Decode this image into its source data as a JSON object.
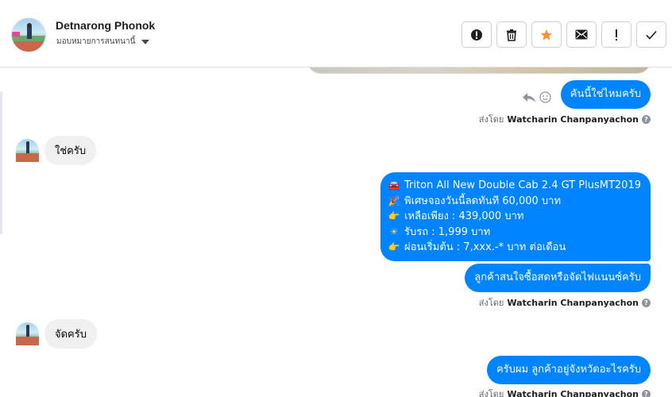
{
  "header": {
    "contact_name": "Detnarong Phonok",
    "assign_label": "มอบหมายการสนทนานี้"
  },
  "actions": [
    {
      "name": "spam-icon",
      "glyph": "!"
    },
    {
      "name": "trash-icon",
      "glyph": ""
    },
    {
      "name": "star-icon",
      "glyph": "★",
      "color": "#f7923b"
    },
    {
      "name": "mail-icon",
      "glyph": ""
    },
    {
      "name": "follow-up-icon",
      "glyph": "!"
    },
    {
      "name": "done-icon",
      "glyph": "✓"
    }
  ],
  "thread": {
    "msg1": "คันนี้ใช่ไหมครับ",
    "sent_by_prefix": "ส่งโดย",
    "sender": "Watcharin Chanpanyachon",
    "reply1": "ใช่ครับ",
    "promo_lines": [
      {
        "emoji": "🚘",
        "text": "Triton All New Double Cab 2.4 GT PlusMT2019"
      },
      {
        "emoji": "🎉",
        "text": "พิเศษจองวันนี้ลดทันที 60,000 บาท"
      },
      {
        "emoji": "👉",
        "text": "เหลือเพียง : 439,000 บาท"
      },
      {
        "emoji": "☀",
        "text": "รับรถ : 1,999 บาท"
      },
      {
        "emoji": "👉",
        "text": "ผ่อนเริ่มต้น : 7,xxx.-* บาท ต่อเดือน"
      }
    ],
    "msg3": "ลูกค้าสนใจซื้อสดหรือจัดไฟแนนซ์ครับ",
    "reply2": "จัดครับ",
    "msg4": "ครับผม ลูกค้าอยู่จังหวัดอะไรครับ"
  },
  "colors": {
    "outgoing": "#0084ff",
    "incoming": "#f0f0f0",
    "star": "#f7923b"
  }
}
